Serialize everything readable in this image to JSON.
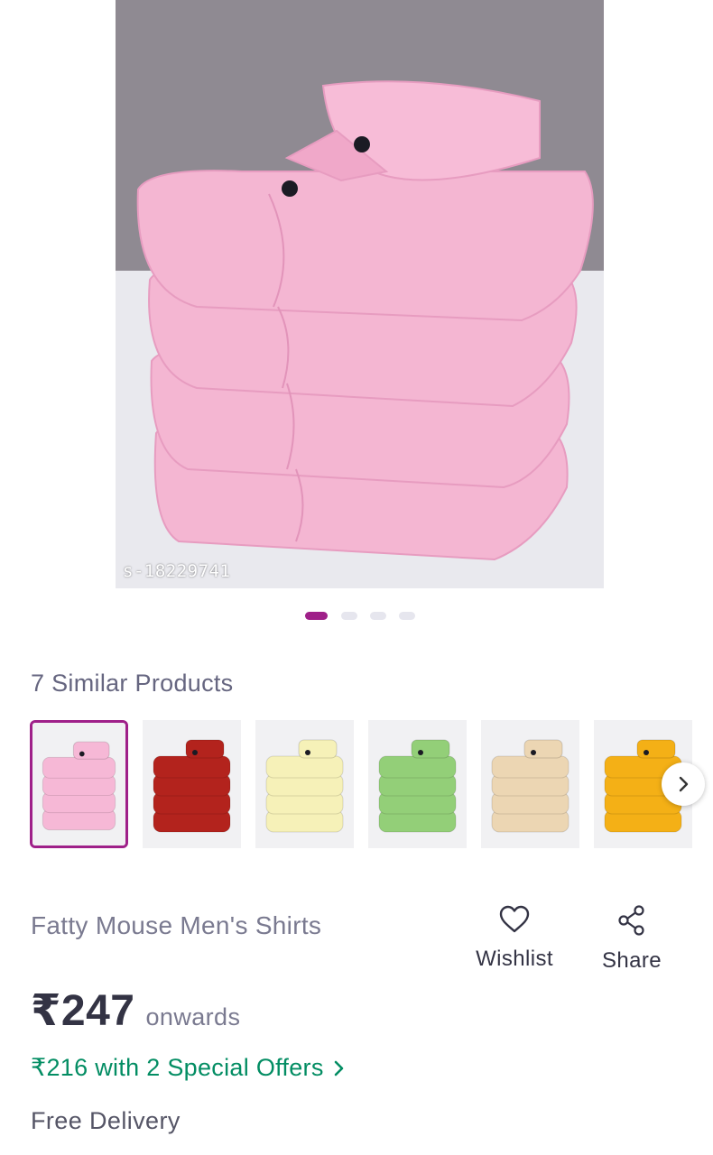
{
  "hero": {
    "image_label": "pink-shirts-stack",
    "product_code": "s-18229741",
    "slide_count": 4,
    "active_slide": 1
  },
  "similar": {
    "title": "7 Similar Products",
    "thumbnails": [
      {
        "name": "pink",
        "color": "#f6b8d6",
        "selected": true
      },
      {
        "name": "maroon",
        "color": "#b3231d",
        "selected": false
      },
      {
        "name": "cream",
        "color": "#f6f1b8",
        "selected": false
      },
      {
        "name": "green",
        "color": "#93cf78",
        "selected": false
      },
      {
        "name": "beige",
        "color": "#ecd6b3",
        "selected": false
      },
      {
        "name": "mustard",
        "color": "#f4b016",
        "selected": false
      }
    ],
    "next_icon": "chevron-right-icon"
  },
  "product": {
    "name": "Fatty Mouse Men's Shirts",
    "price": "₹247",
    "price_suffix": "onwards",
    "offer_text": "₹216 with 2 Special Offers",
    "delivery": "Free Delivery"
  },
  "actions": {
    "wishlist_label": "Wishlist",
    "wishlist_icon": "heart-icon",
    "share_label": "Share",
    "share_icon": "share-icon"
  },
  "colors": {
    "accent": "#9f2089",
    "offer_green": "#038d63",
    "muted_text": "#7a7a90"
  }
}
